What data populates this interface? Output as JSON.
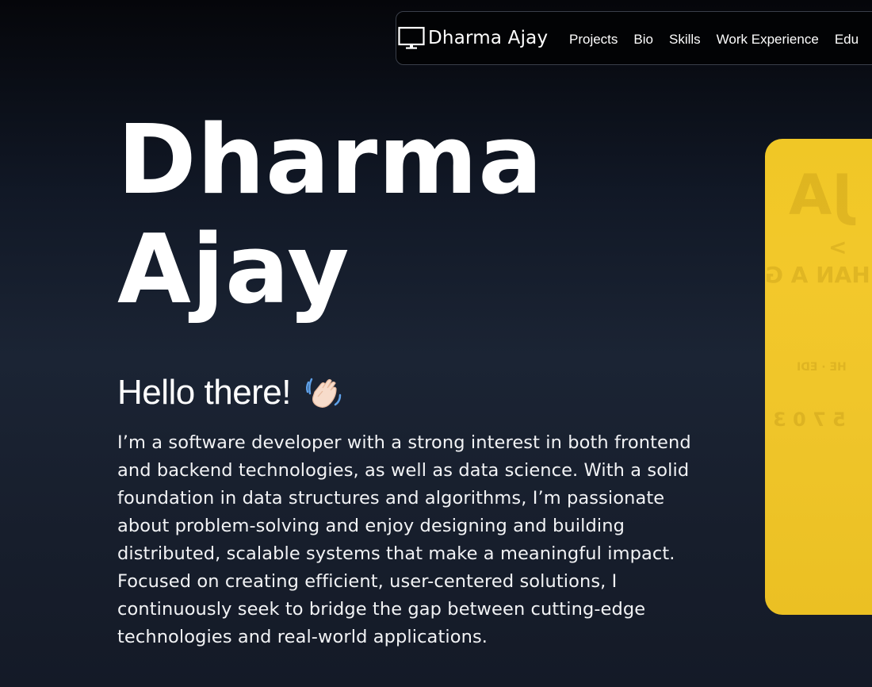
{
  "nav": {
    "brand": "Dharma Ajay",
    "brand_icon": "monitor-icon",
    "links": [
      "Projects",
      "Bio",
      "Skills",
      "Work Experience",
      "Edu"
    ]
  },
  "hero": {
    "name_line1": "Dharma",
    "name_line2": "Ajay",
    "greeting": "Hello there!",
    "greeting_icon": "waving-hand-icon",
    "intro": "I’m a software developer with a strong interest in both frontend and backend technologies, as well as data science. With a solid foundation in data structures and algorithms, I’m passionate about problem-solving and enjoy designing and building distributed, scalable systems that make a meaningful impact. Focused on creating efficient, user-centered solutions, I continuously seek to bridge the gap between cutting-edge technologies and real-world applications."
  },
  "colors": {
    "background_top": "#05060a",
    "background_mid": "#1b2434",
    "photo_card": "#f0c726",
    "text": "#ffffff"
  }
}
